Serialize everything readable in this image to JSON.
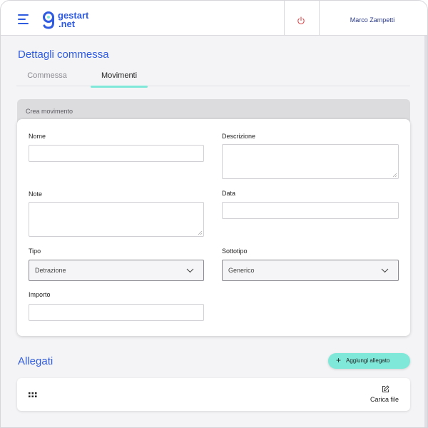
{
  "app": {
    "logo_line1": "gestart",
    "logo_line2": ".net",
    "brand_color": "#2f5be0",
    "accent_color": "#7fe8d9"
  },
  "header": {
    "user_name": "Marco Zampetti",
    "menu_icon": "hamburger-icon",
    "power_icon": "power-icon"
  },
  "page": {
    "title": "Dettagli commessa"
  },
  "tabs": [
    {
      "label": "Commessa",
      "active": false
    },
    {
      "label": "Movimenti",
      "active": true
    }
  ],
  "form": {
    "section_title": "Crea movimento",
    "nome": {
      "label": "Nome",
      "value": ""
    },
    "descrizione": {
      "label": "Descrizione",
      "value": ""
    },
    "note": {
      "label": "Note",
      "value": ""
    },
    "data": {
      "label": "Data",
      "value": ""
    },
    "tipo": {
      "label": "Tipo",
      "value": "Detrazione"
    },
    "sottotipo": {
      "label": "Sottotipo",
      "value": "Generico"
    },
    "importo": {
      "label": "Importo",
      "value": ""
    }
  },
  "allegati": {
    "title": "Allegati",
    "add_label": "Aggiungi allegato",
    "add_icon": "plus-icon",
    "upload_label": "Carica file",
    "upload_icon": "edit-icon",
    "grid_icon": "grid-icon"
  }
}
